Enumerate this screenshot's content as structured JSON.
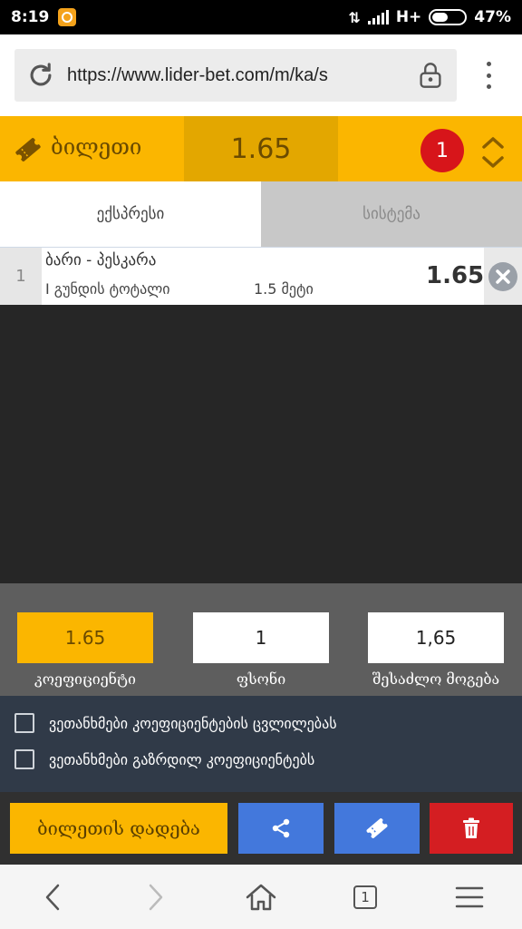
{
  "status_bar": {
    "time": "8:19",
    "network": "H+",
    "battery": "47%"
  },
  "browser": {
    "url": "https://www.lider-bet.com/m/ka/s"
  },
  "ticket": {
    "title": "ბილეთი",
    "total_odds": "1.65",
    "count": "1"
  },
  "tabs": [
    {
      "label": "ექსპრესი",
      "active": true
    },
    {
      "label": "სისტემა",
      "active": false
    }
  ],
  "bets": [
    {
      "number": "1",
      "teams": "ბარი - პესკარა",
      "market": "I გუნდის ტოტალი",
      "line": "1.5 მეტი",
      "odds": "1.65"
    }
  ],
  "summary": {
    "odds_value": "1.65",
    "odds_label": "კოეფიციენტი",
    "stake_value": "1",
    "stake_label": "ფსონი",
    "win_value": "1,65",
    "win_label": "შესაძლო მოგება"
  },
  "options": [
    {
      "label": "ვეთანხმები კოეფიციენტების ცვლილებას",
      "checked": false
    },
    {
      "label": "ვეთანხმები გაზრდილ კოეფიციენტებს",
      "checked": false
    }
  ],
  "actions": {
    "place_label": "ბილეთის დადება"
  },
  "nav": {
    "tab_count": "1"
  },
  "colors": {
    "accent": "#fbb600",
    "accent_dark": "#e3a700",
    "badge": "#d7151a",
    "blue": "#4378dc",
    "red": "#d41e22"
  },
  "icons": [
    "reload-icon",
    "lock-icon",
    "ticket-icon",
    "expand-icon",
    "remove-icon",
    "share-icon",
    "trash-icon",
    "back-icon",
    "forward-icon",
    "home-icon",
    "menu-icon"
  ]
}
